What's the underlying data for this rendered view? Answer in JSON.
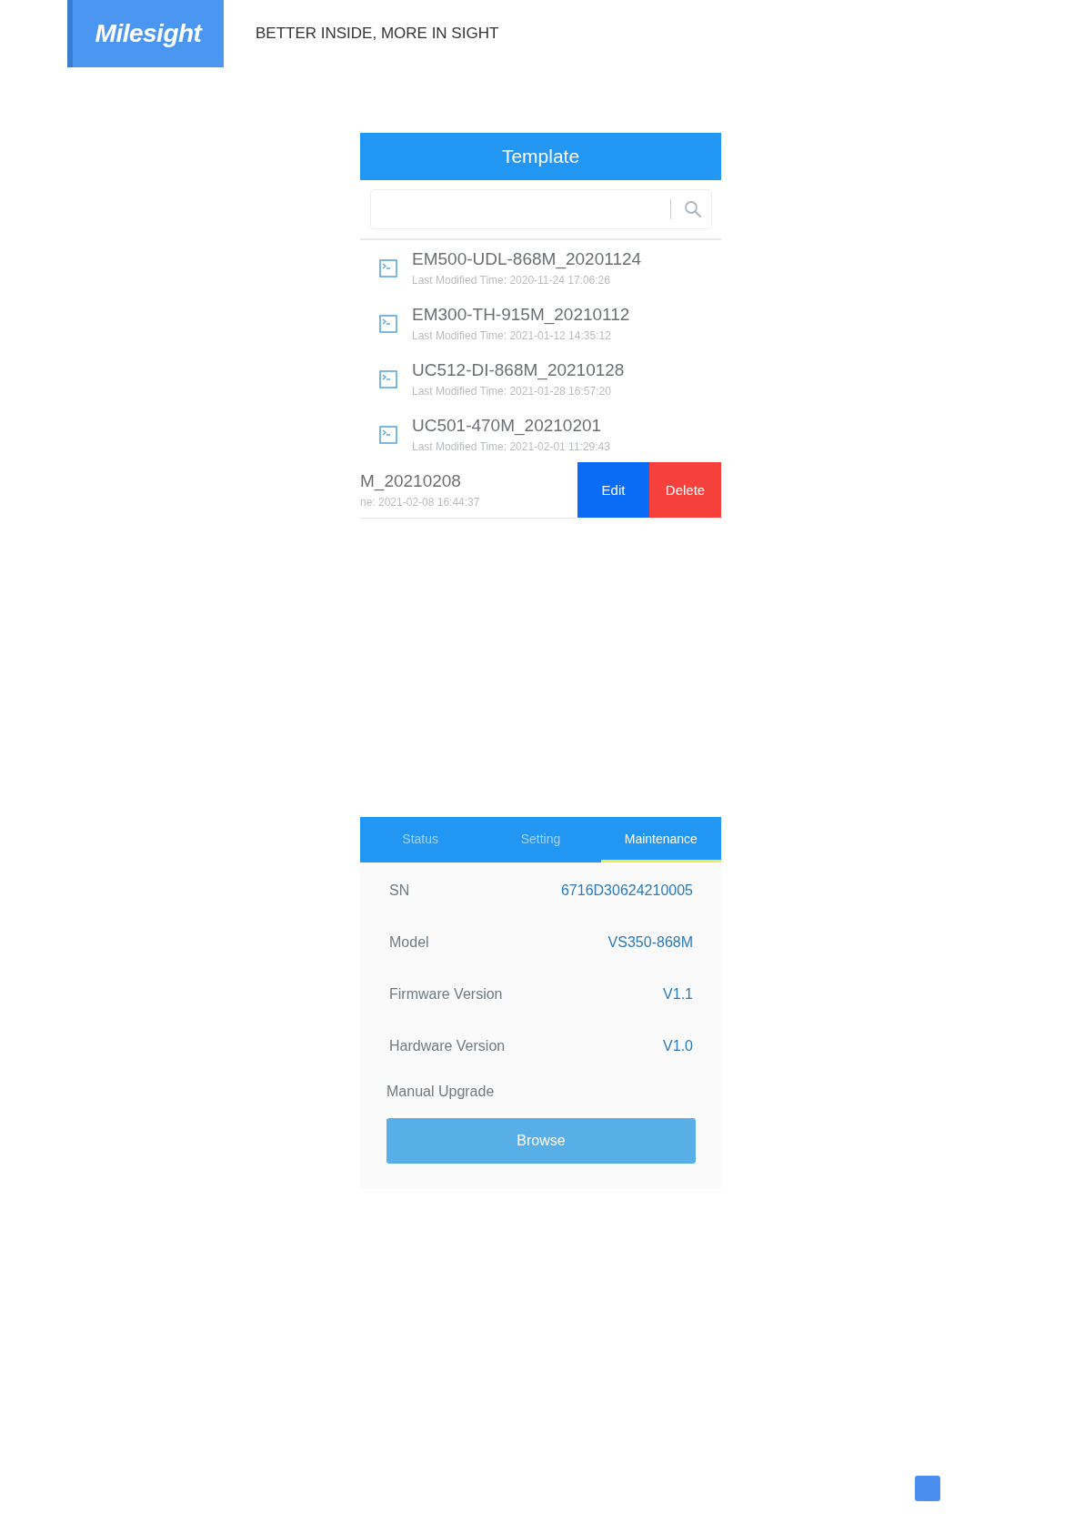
{
  "header": {
    "logo": "Milesight",
    "tagline": "BETTER INSIDE, MORE IN SIGHT"
  },
  "template_screen": {
    "title": "Template",
    "items": [
      {
        "name": "EM500-UDL-868M_20201124",
        "modified": "Last Modified Time: 2020-11-24 17:06:26",
        "swiped": false
      },
      {
        "name": "EM300-TH-915M_20210112",
        "modified": "Last Modified Time: 2021-01-12 14:35:12",
        "swiped": false
      },
      {
        "name": "UC512-DI-868M_20210128",
        "modified": "Last Modified Time: 2021-01-28 16:57:20",
        "swiped": false
      },
      {
        "name": "UC501-470M_20210201",
        "modified": "Last Modified Time: 2021-02-01 11:29:43",
        "swiped": false
      },
      {
        "name": "M_20210208",
        "modified": "ne: 2021-02-08 16:44:37",
        "swiped": true,
        "actions": [
          {
            "label": "Edit",
            "kind": "edit"
          },
          {
            "label": "Delete",
            "kind": "delete"
          }
        ]
      }
    ]
  },
  "maintenance_screen": {
    "tabs": [
      {
        "label": "Status",
        "selected": false
      },
      {
        "label": "Setting",
        "selected": false
      },
      {
        "label": "Maintenance",
        "selected": true
      }
    ],
    "fields": [
      {
        "label": "SN",
        "value": "6716D30624210005"
      },
      {
        "label": "Model",
        "value": "VS350-868M"
      },
      {
        "label": "Firmware Version",
        "value": "V1.1"
      },
      {
        "label": "Hardware Version",
        "value": "V1.0"
      }
    ],
    "upgrade_label": "Manual Upgrade",
    "browse_button": "Browse"
  }
}
